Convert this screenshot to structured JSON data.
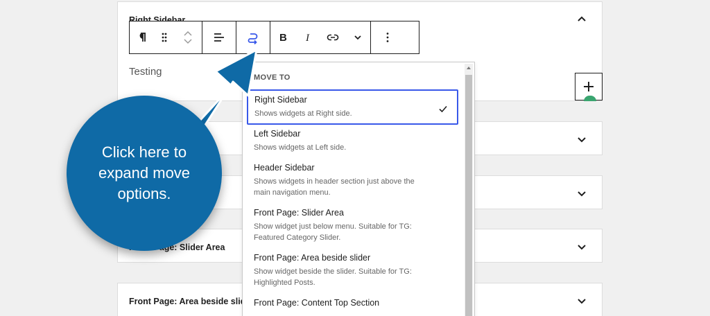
{
  "panels": [
    {
      "title": "Right Sidebar",
      "content": "Testing"
    },
    {
      "title": ""
    },
    {
      "title": ""
    },
    {
      "title": "Front Page: Slider Area"
    },
    {
      "title": "Front Page: Area beside slid"
    }
  ],
  "toolbar": {
    "buttons": [
      "paragraph-icon",
      "drag-handle-icon",
      "move-up-icon",
      "move-down-icon",
      "align-left-icon",
      "move-to-icon",
      "bold-icon",
      "italic-icon",
      "link-icon",
      "chevron-down-icon",
      "more-options-icon"
    ]
  },
  "dropdown": {
    "heading": "MOVE TO",
    "items": [
      {
        "title": "Right Sidebar",
        "desc": "Shows widgets at Right side.",
        "selected": true
      },
      {
        "title": "Left Sidebar",
        "desc": "Shows widgets at Left side."
      },
      {
        "title": "Header Sidebar",
        "desc": "Shows widgets in header section just above the main navigation menu."
      },
      {
        "title": "Front Page: Slider Area",
        "desc": "Show widget just below menu. Suitable for TG: Featured Category Slider."
      },
      {
        "title": "Front Page: Area beside slider",
        "desc": "Show widget beside the slider. Suitable for TG: Highlighted Posts."
      },
      {
        "title": "Front Page: Content Top Section",
        "desc": ""
      }
    ]
  },
  "callout": {
    "text": "Click here to expand move options."
  },
  "colors": {
    "callout": "#0f6aa6",
    "selected_border": "#3858e9",
    "accent_green": "#3aa570"
  }
}
